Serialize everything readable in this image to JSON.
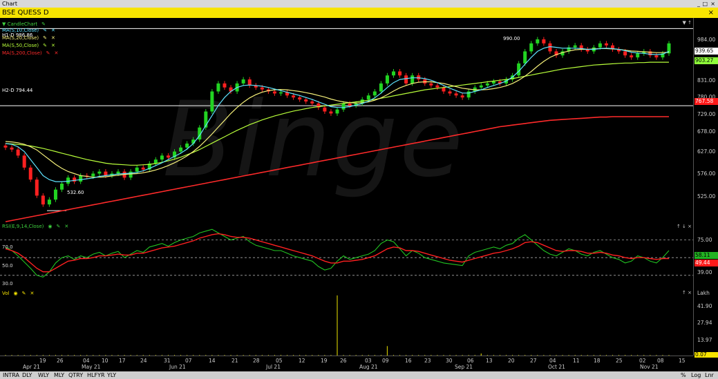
{
  "window": {
    "title": "Chart",
    "controls": [
      "_",
      "□",
      "×"
    ]
  },
  "symbol_bar": {
    "symbol": "BSE QUESS D",
    "close": "×"
  },
  "watermark": "Binge",
  "price_pane": {
    "legend": [
      {
        "label": "▼ CandleChart",
        "color": "#3fd13f"
      },
      {
        "label": "MA(S,10,Close)",
        "color": "#5ee3ff"
      },
      {
        "label": "MA(S,20,Close)",
        "color": "#f5f07a"
      },
      {
        "label": "MA(S,50,Close)",
        "color": "#b8ff3a"
      },
      {
        "label": "MA(S,200,Close)",
        "color": "#ff2a2a"
      }
    ],
    "h1_label": "H1-D 986.86",
    "h2_label": "H2-D 794.44",
    "high_annotation": "990.00",
    "low_annotation": "532.60",
    "y_ticks": [
      "984.00",
      "831.00",
      "780.00",
      "729.00",
      "678.00",
      "627.00",
      "576.00",
      "525.00"
    ],
    "badges": [
      {
        "text": "939.65",
        "bg": "#ffffff",
        "fg": "#000000"
      },
      {
        "text": "903.27",
        "bg": "#8fff3a",
        "fg": "#000000"
      },
      {
        "text": "767.58",
        "bg": "#ff1a1a",
        "fg": "#ffffff"
      }
    ]
  },
  "rsi_pane": {
    "title": "RSI(E,9,14,Close)",
    "levels": [
      "70.0",
      "50.0",
      "30.0"
    ],
    "y_ticks": [
      "75.00",
      "39.00"
    ],
    "badges": [
      {
        "text": "58.11",
        "bg": "#22b322",
        "fg": "#000000"
      },
      {
        "text": "49.44",
        "bg": "#ff1a1a",
        "fg": "#ffffff"
      }
    ]
  },
  "vol_pane": {
    "title": "Vol",
    "unit": "Lakh",
    "y_ticks": [
      "41.90",
      "27.94",
      "13.97"
    ],
    "badge": {
      "text": "0.07",
      "bg": "#f7e400",
      "fg": "#000000"
    }
  },
  "x_axis": {
    "days": [
      "19",
      "26",
      "04",
      "10",
      "17",
      "24",
      "31",
      "07",
      "14",
      "21",
      "28",
      "05",
      "12",
      "19",
      "26",
      "03",
      "09",
      "16",
      "23",
      "30",
      "06",
      "13",
      "20",
      "27",
      "04",
      "11",
      "18",
      "25",
      "02",
      "08",
      "15"
    ],
    "months": [
      "Apr 21",
      "May 21",
      "Jun 21",
      "Jul 21",
      "Aug 21",
      "Sep 21",
      "Oct 21",
      "Nov 21"
    ]
  },
  "bottom_bar": {
    "timeframes": [
      "INTRA",
      "DLY",
      "WLY",
      "MLY",
      "QTRY",
      "HLFYR",
      "YLY"
    ],
    "right": [
      "%",
      "Log",
      "Lnr"
    ]
  },
  "chart_data": {
    "type": "candlestick",
    "title": "BSE QUESS D",
    "ylim": [
      500,
      1010
    ],
    "close": [
      690,
      685,
      670,
      640,
      610,
      570,
      548,
      560,
      585,
      600,
      615,
      605,
      620,
      618,
      625,
      630,
      620,
      625,
      630,
      615,
      630,
      640,
      635,
      650,
      660,
      670,
      665,
      680,
      690,
      700,
      710,
      740,
      780,
      830,
      850,
      840,
      830,
      850,
      860,
      845,
      840,
      835,
      830,
      825,
      828,
      820,
      815,
      810,
      805,
      800,
      790,
      780,
      775,
      785,
      800,
      795,
      800,
      810,
      820,
      830,
      850,
      870,
      880,
      870,
      850,
      870,
      860,
      850,
      845,
      840,
      830,
      825,
      820,
      815,
      830,
      840,
      845,
      850,
      855,
      850,
      860,
      870,
      900,
      930,
      950,
      960,
      950,
      930,
      920,
      930,
      940,
      945,
      935,
      930,
      940,
      950,
      945,
      935,
      930,
      920,
      915,
      925,
      930,
      920,
      915,
      925,
      950
    ],
    "ma10": [
      700,
      698,
      692,
      680,
      660,
      640,
      620,
      610,
      605,
      605,
      606,
      608,
      610,
      612,
      614,
      618,
      620,
      622,
      624,
      625,
      626,
      628,
      632,
      638,
      645,
      652,
      660,
      668,
      676,
      686,
      700,
      720,
      745,
      770,
      795,
      815,
      830,
      840,
      845,
      846,
      845,
      843,
      840,
      836,
      832,
      828,
      824,
      820,
      815,
      810,
      804,
      798,
      792,
      790,
      790,
      792,
      796,
      800,
      806,
      814,
      826,
      840,
      852,
      860,
      862,
      864,
      864,
      862,
      858,
      852,
      845,
      838,
      832,
      826,
      826,
      830,
      834,
      840,
      845,
      850,
      856,
      866,
      880,
      898,
      915,
      930,
      938,
      942,
      940,
      938,
      938,
      938,
      937,
      935,
      935,
      937,
      938,
      937,
      935,
      932,
      928,
      926,
      925,
      923,
      922,
      923,
      930
    ],
    "ma20": [
      705,
      704,
      702,
      698,
      692,
      684,
      672,
      660,
      648,
      638,
      630,
      625,
      620,
      618,
      616,
      616,
      617,
      619,
      621,
      623,
      624,
      625,
      627,
      630,
      634,
      639,
      645,
      652,
      660,
      669,
      680,
      693,
      708,
      724,
      741,
      758,
      775,
      790,
      803,
      814,
      822,
      828,
      832,
      834,
      835,
      834,
      832,
      830,
      827,
      824,
      820,
      816,
      811,
      807,
      804,
      802,
      801,
      802,
      804,
      808,
      814,
      822,
      831,
      839,
      845,
      850,
      853,
      854,
      854,
      852,
      850,
      846,
      842,
      838,
      836,
      834,
      834,
      835,
      837,
      840,
      844,
      850,
      858,
      868,
      880,
      893,
      905,
      915,
      922,
      927,
      931,
      934,
      935,
      935,
      936,
      937,
      937,
      936,
      935,
      933,
      931,
      930,
      929,
      928,
      927,
      927,
      928
    ],
    "ma50": [
      700,
      699,
      698,
      696,
      694,
      691,
      688,
      684,
      680,
      676,
      672,
      668,
      664,
      660,
      657,
      654,
      651,
      649,
      648,
      647,
      646,
      646,
      647,
      648,
      650,
      653,
      657,
      661,
      666,
      672,
      678,
      685,
      693,
      701,
      709,
      717,
      725,
      733,
      740,
      747,
      753,
      759,
      764,
      769,
      773,
      777,
      781,
      784,
      787,
      790,
      792,
      794,
      796,
      798,
      800,
      802,
      804,
      806,
      808,
      810,
      813,
      816,
      819,
      822,
      825,
      828,
      831,
      834,
      836,
      838,
      840,
      842,
      844,
      846,
      848,
      850,
      852,
      854,
      856,
      858,
      860,
      862,
      865,
      868,
      871,
      874,
      877,
      880,
      883,
      886,
      888,
      890,
      892,
      894,
      896,
      897,
      898,
      899,
      900,
      901,
      901,
      902,
      902,
      903,
      903,
      903,
      903
    ],
    "ma200": [
      505,
      508,
      511,
      514,
      517,
      520,
      523,
      526,
      529,
      532,
      535,
      538,
      541,
      544,
      547,
      550,
      553,
      556,
      559,
      562,
      565,
      568,
      571,
      574,
      577,
      580,
      583,
      586,
      589,
      592,
      595,
      598,
      601,
      604,
      607,
      610,
      613,
      616,
      619,
      622,
      625,
      628,
      631,
      634,
      637,
      640,
      643,
      646,
      649,
      652,
      655,
      658,
      661,
      664,
      667,
      670,
      673,
      676,
      679,
      682,
      685,
      688,
      691,
      694,
      697,
      700,
      703,
      706,
      709,
      712,
      715,
      718,
      721,
      724,
      727,
      730,
      733,
      736,
      739,
      742,
      744,
      746,
      748,
      750,
      752,
      754,
      756,
      758,
      759,
      760,
      761,
      762,
      763,
      764,
      765,
      766,
      766,
      767,
      767,
      767,
      767,
      767,
      767,
      767,
      767,
      767,
      767
    ],
    "rsi": [
      62,
      58,
      52,
      45,
      38,
      30,
      28,
      34,
      44,
      50,
      52,
      48,
      52,
      50,
      54,
      56,
      52,
      55,
      57,
      50,
      54,
      58,
      56,
      62,
      64,
      66,
      63,
      67,
      70,
      72,
      74,
      78,
      80,
      82,
      78,
      74,
      70,
      72,
      74,
      68,
      64,
      62,
      60,
      58,
      58,
      55,
      52,
      50,
      48,
      46,
      40,
      36,
      38,
      46,
      52,
      48,
      50,
      52,
      54,
      58,
      66,
      70,
      68,
      60,
      52,
      58,
      55,
      50,
      48,
      46,
      44,
      43,
      42,
      41,
      52,
      56,
      58,
      60,
      62,
      60,
      64,
      66,
      72,
      76,
      70,
      64,
      58,
      54,
      52,
      56,
      60,
      58,
      54,
      52,
      56,
      58,
      54,
      50,
      48,
      44,
      46,
      52,
      50,
      46,
      44,
      50,
      58
    ],
    "rsi_signal": [
      60,
      58,
      55,
      50,
      44,
      38,
      34,
      34,
      38,
      42,
      46,
      47,
      49,
      49,
      50,
      52,
      52,
      53,
      54,
      53,
      53,
      55,
      55,
      57,
      59,
      61,
      62,
      63,
      65,
      67,
      69,
      72,
      74,
      76,
      77,
      76,
      74,
      73,
      73,
      72,
      70,
      68,
      66,
      64,
      62,
      60,
      58,
      56,
      54,
      52,
      49,
      46,
      44,
      44,
      46,
      46,
      47,
      48,
      50,
      52,
      56,
      60,
      62,
      61,
      58,
      58,
      57,
      55,
      53,
      51,
      49,
      47,
      46,
      45,
      47,
      49,
      51,
      53,
      55,
      56,
      58,
      60,
      63,
      67,
      68,
      67,
      64,
      61,
      58,
      57,
      58,
      58,
      57,
      55,
      55,
      56,
      55,
      53,
      52,
      50,
      49,
      50,
      50,
      49,
      48,
      49,
      49
    ],
    "volume_spikes": [
      {
        "index": 48,
        "value": 44.5
      },
      {
        "index": 59,
        "value": 7.0
      },
      {
        "index": 75,
        "value": 1.5
      }
    ]
  }
}
